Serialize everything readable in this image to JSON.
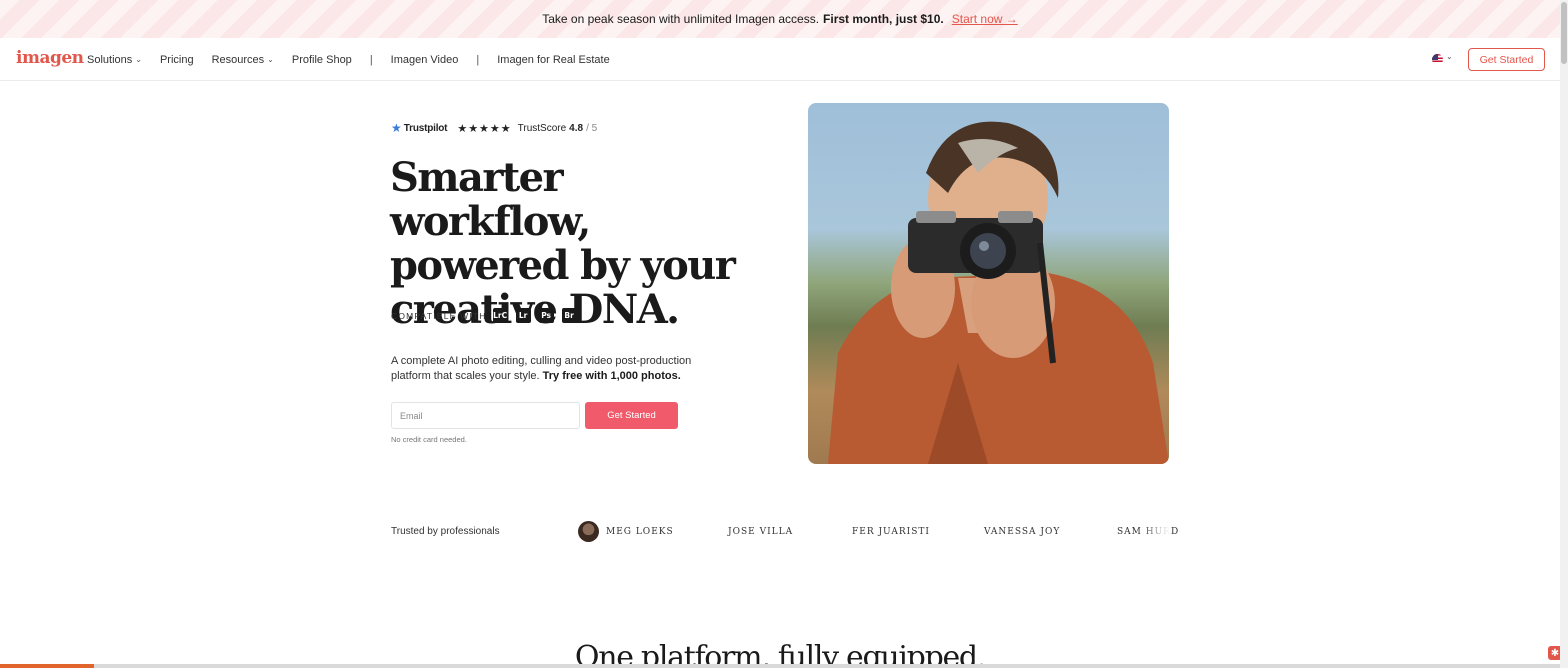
{
  "announcement": {
    "text": "Take on peak season with unlimited Imagen access.",
    "bold": "First month, just $10.",
    "link": "Start now →"
  },
  "nav": {
    "logo": "imagen",
    "items": [
      {
        "label": "Solutions",
        "has_dropdown": true
      },
      {
        "label": "Pricing",
        "has_dropdown": false
      },
      {
        "label": "Resources",
        "has_dropdown": true
      },
      {
        "label": "Profile Shop",
        "has_dropdown": false
      },
      {
        "label": "Imagen Video",
        "has_dropdown": false
      },
      {
        "label": "Imagen for Real Estate",
        "has_dropdown": false
      }
    ],
    "separator": "|",
    "language_icon": "us-flag-icon",
    "cta": "Get Started"
  },
  "hero": {
    "trustpilot": {
      "brand": "Trustpilot",
      "stars": "★★★★★",
      "score_label": "TrustScore",
      "score": "4.8",
      "max": "/ 5"
    },
    "headline_lines": [
      "Smarter workflow,",
      "powered by your",
      "creative DNA."
    ],
    "compatible_label": "COMPATIBLE WITH",
    "apps": [
      "LrC",
      "Lr",
      "Ps",
      "Br"
    ],
    "description": "A complete AI photo editing, culling and video post-production platform that scales your style.",
    "description_bold": "Try free with 1,000 photos.",
    "email_placeholder": "Email",
    "cta": "Get Started",
    "note": "No credit card needed."
  },
  "trusted": {
    "label": "Trusted by professionals",
    "names": [
      "MEG LOEKS",
      "JOSE VILLA",
      "FER JUARISTI",
      "VANESSA JOY",
      "SAM HURD"
    ]
  },
  "section": {
    "heading": "One platform, fully equipped."
  },
  "colors": {
    "brand": "#e2574c",
    "cta": "#f05a6b",
    "progress": "#e0642b"
  },
  "progress_fraction": 0.06
}
